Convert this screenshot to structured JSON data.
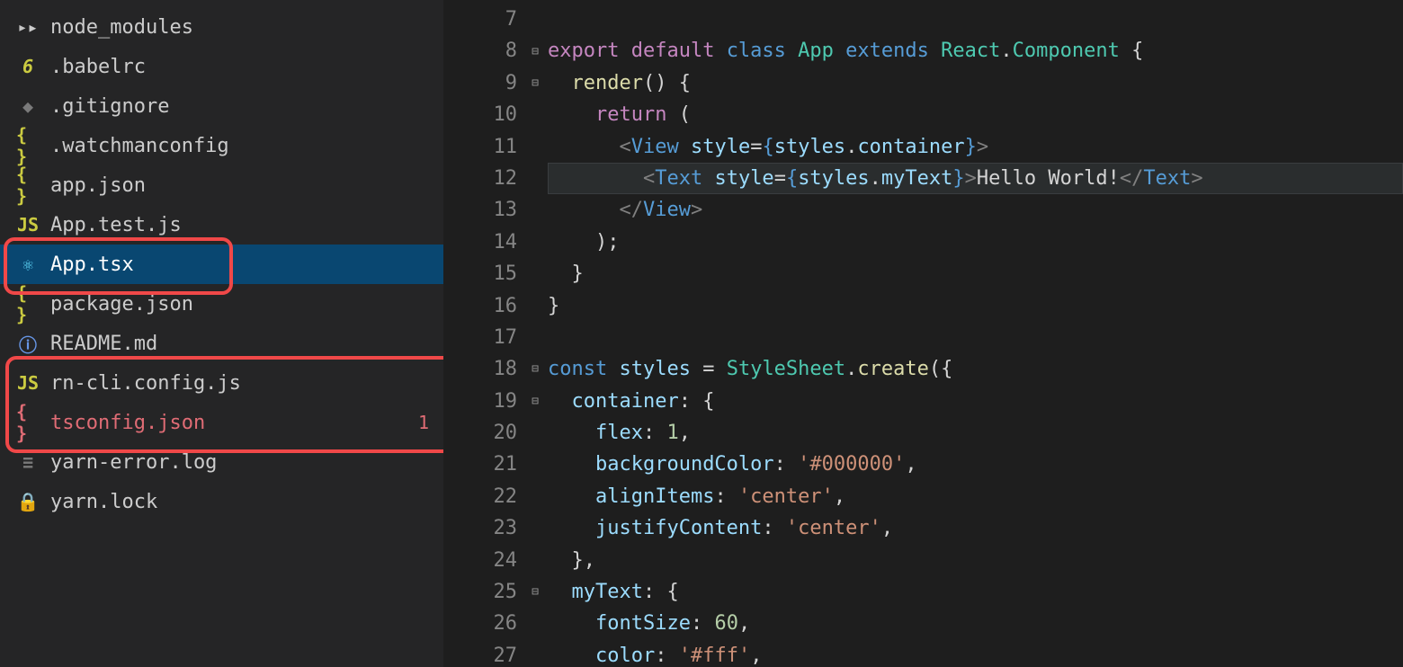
{
  "sidebar": {
    "files": [
      {
        "name": "node_modules",
        "icon": "folder",
        "iconText": "▸",
        "selected": false,
        "error": false
      },
      {
        "name": ".babelrc",
        "icon": "babel",
        "iconText": "6",
        "selected": false,
        "error": false
      },
      {
        "name": ".gitignore",
        "icon": "git",
        "iconText": "◆",
        "selected": false,
        "error": false
      },
      {
        "name": ".watchmanconfig",
        "icon": "json",
        "iconText": "{ }",
        "selected": false,
        "error": false
      },
      {
        "name": "app.json",
        "icon": "json",
        "iconText": "{ }",
        "selected": false,
        "error": false
      },
      {
        "name": "App.test.js",
        "icon": "js",
        "iconText": "JS",
        "selected": false,
        "error": false
      },
      {
        "name": "App.tsx",
        "icon": "react",
        "iconText": "⚛",
        "selected": true,
        "error": false
      },
      {
        "name": "package.json",
        "icon": "json",
        "iconText": "{ }",
        "selected": false,
        "error": false
      },
      {
        "name": "README.md",
        "icon": "info",
        "iconText": "ⓘ",
        "selected": false,
        "error": false
      },
      {
        "name": "rn-cli.config.js",
        "icon": "js",
        "iconText": "JS",
        "selected": false,
        "error": false
      },
      {
        "name": "tsconfig.json",
        "icon": "json-red",
        "iconText": "{ }",
        "selected": false,
        "error": true,
        "badge": "1"
      },
      {
        "name": "yarn-error.log",
        "icon": "log",
        "iconText": "≡",
        "selected": false,
        "error": false
      },
      {
        "name": "yarn.lock",
        "icon": "lock",
        "iconText": "🔒",
        "selected": false,
        "error": false
      }
    ]
  },
  "editor": {
    "gutterStart": 7,
    "gutterEnd": 27,
    "fold": {
      "8": "⊟",
      "9": "⊟",
      "11": "",
      "18": "⊟",
      "19": "⊟",
      "25": "⊟"
    },
    "currentLine": 12,
    "lines": {
      "7": [],
      "8": [
        {
          "t": "export ",
          "c": "kw"
        },
        {
          "t": "default ",
          "c": "kw"
        },
        {
          "t": "class ",
          "c": "mod"
        },
        {
          "t": "App ",
          "c": "type"
        },
        {
          "t": "extends ",
          "c": "mod"
        },
        {
          "t": "React",
          "c": "type"
        },
        {
          "t": ".",
          "c": "punc"
        },
        {
          "t": "Component ",
          "c": "type"
        },
        {
          "t": "{",
          "c": "punc"
        }
      ],
      "9": [
        {
          "t": "  ",
          "c": "punc"
        },
        {
          "t": "render",
          "c": "fn"
        },
        {
          "t": "() {",
          "c": "punc"
        }
      ],
      "10": [
        {
          "t": "    ",
          "c": "punc"
        },
        {
          "t": "return ",
          "c": "kw"
        },
        {
          "t": "(",
          "c": "punc"
        }
      ],
      "11": [
        {
          "t": "      ",
          "c": "punc"
        },
        {
          "t": "<",
          "c": "angle"
        },
        {
          "t": "View ",
          "c": "tag"
        },
        {
          "t": "style",
          "c": "var"
        },
        {
          "t": "=",
          "c": "punc"
        },
        {
          "t": "{",
          "c": "mod"
        },
        {
          "t": "styles",
          "c": "var"
        },
        {
          "t": ".",
          "c": "punc"
        },
        {
          "t": "container",
          "c": "var"
        },
        {
          "t": "}",
          "c": "mod"
        },
        {
          "t": ">",
          "c": "angle"
        }
      ],
      "12": [
        {
          "t": "        ",
          "c": "punc"
        },
        {
          "t": "<",
          "c": "angle"
        },
        {
          "t": "Text ",
          "c": "tag"
        },
        {
          "t": "style",
          "c": "var"
        },
        {
          "t": "=",
          "c": "punc"
        },
        {
          "t": "{",
          "c": "mod"
        },
        {
          "t": "styles",
          "c": "var"
        },
        {
          "t": ".",
          "c": "punc"
        },
        {
          "t": "myText",
          "c": "var"
        },
        {
          "t": "}",
          "c": "mod"
        },
        {
          "t": ">",
          "c": "angle"
        },
        {
          "t": "Hello World!",
          "c": "text"
        },
        {
          "t": "</",
          "c": "angle"
        },
        {
          "t": "Text",
          "c": "tag"
        },
        {
          "t": ">",
          "c": "angle"
        }
      ],
      "13": [
        {
          "t": "      ",
          "c": "punc"
        },
        {
          "t": "</",
          "c": "angle"
        },
        {
          "t": "View",
          "c": "tag"
        },
        {
          "t": ">",
          "c": "angle"
        }
      ],
      "14": [
        {
          "t": "    );",
          "c": "punc"
        }
      ],
      "15": [
        {
          "t": "  }",
          "c": "punc"
        }
      ],
      "16": [
        {
          "t": "}",
          "c": "punc"
        }
      ],
      "17": [],
      "18": [
        {
          "t": "const ",
          "c": "mod"
        },
        {
          "t": "styles ",
          "c": "var"
        },
        {
          "t": "= ",
          "c": "punc"
        },
        {
          "t": "StyleSheet",
          "c": "type"
        },
        {
          "t": ".",
          "c": "punc"
        },
        {
          "t": "create",
          "c": "fn"
        },
        {
          "t": "({",
          "c": "punc"
        }
      ],
      "19": [
        {
          "t": "  ",
          "c": "punc"
        },
        {
          "t": "container",
          "c": "var"
        },
        {
          "t": ": {",
          "c": "punc"
        }
      ],
      "20": [
        {
          "t": "    ",
          "c": "punc"
        },
        {
          "t": "flex",
          "c": "var"
        },
        {
          "t": ": ",
          "c": "punc"
        },
        {
          "t": "1",
          "c": "num"
        },
        {
          "t": ",",
          "c": "punc"
        }
      ],
      "21": [
        {
          "t": "    ",
          "c": "punc"
        },
        {
          "t": "backgroundColor",
          "c": "var"
        },
        {
          "t": ": ",
          "c": "punc"
        },
        {
          "t": "'#000000'",
          "c": "str"
        },
        {
          "t": ",",
          "c": "punc"
        }
      ],
      "22": [
        {
          "t": "    ",
          "c": "punc"
        },
        {
          "t": "alignItems",
          "c": "var"
        },
        {
          "t": ": ",
          "c": "punc"
        },
        {
          "t": "'center'",
          "c": "str"
        },
        {
          "t": ",",
          "c": "punc"
        }
      ],
      "23": [
        {
          "t": "    ",
          "c": "punc"
        },
        {
          "t": "justifyContent",
          "c": "var"
        },
        {
          "t": ": ",
          "c": "punc"
        },
        {
          "t": "'center'",
          "c": "str"
        },
        {
          "t": ",",
          "c": "punc"
        }
      ],
      "24": [
        {
          "t": "  },",
          "c": "punc"
        }
      ],
      "25": [
        {
          "t": "  ",
          "c": "punc"
        },
        {
          "t": "myText",
          "c": "var"
        },
        {
          "t": ": {",
          "c": "punc"
        }
      ],
      "26": [
        {
          "t": "    ",
          "c": "punc"
        },
        {
          "t": "fontSize",
          "c": "var"
        },
        {
          "t": ": ",
          "c": "punc"
        },
        {
          "t": "60",
          "c": "num"
        },
        {
          "t": ",",
          "c": "punc"
        }
      ],
      "27": [
        {
          "t": "    ",
          "c": "punc"
        },
        {
          "t": "color",
          "c": "var"
        },
        {
          "t": ": ",
          "c": "punc"
        },
        {
          "t": "'#fff'",
          "c": "str"
        },
        {
          "t": ",",
          "c": "punc"
        }
      ]
    }
  }
}
